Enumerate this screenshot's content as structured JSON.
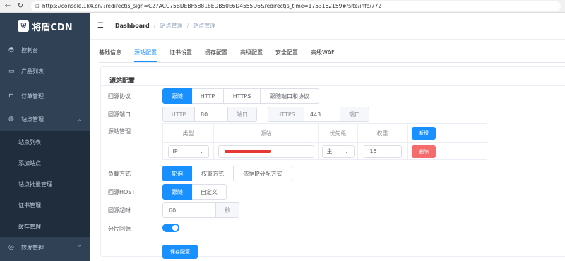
{
  "browser": {
    "url": "https://console.1k4.cn/?redirectjs_sign=C27ACC75BDEBF58818EDB50E6D4555D6&redirectjs_time=1753162159#/site/info/772"
  },
  "sidebar": {
    "logo_text": "将盾CDN",
    "items": [
      {
        "label": "控制台",
        "icon": "dashboard-icon"
      },
      {
        "label": "产品列表",
        "icon": "box-icon"
      },
      {
        "label": "订单管理",
        "icon": "cart-icon"
      },
      {
        "label": "站点管理",
        "icon": "site-icon"
      },
      {
        "label": "转发管理",
        "icon": "forward-icon"
      }
    ],
    "subitems": [
      "站点列表",
      "添加站点",
      "站点批量管理",
      "证书管理",
      "缓存管理"
    ]
  },
  "header": {
    "breadcrumb": [
      "Dashboard",
      "站点管理",
      "站点管理"
    ]
  },
  "tabs": [
    "基础信息",
    "源站配置",
    "证书设置",
    "缓存配置",
    "高级配置",
    "安全配置",
    "高级WAF"
  ],
  "active_tab": "源站配置",
  "form": {
    "title": "源站配置",
    "protocol": {
      "label": "回源协议",
      "options": [
        "跟随",
        "HTTP",
        "HTTPS",
        "跟随端口和协议"
      ],
      "selected": "跟随"
    },
    "port": {
      "label": "回源端口",
      "http_label": "HTTP",
      "http_value": "80",
      "unit1": "端口",
      "https_label": "HTTPS",
      "https_value": "443",
      "unit2": "端口"
    },
    "origin": {
      "label": "源站管理",
      "columns": [
        "类型",
        "源站",
        "优先级",
        "权重"
      ],
      "add_button": "新增",
      "row": {
        "type": "IP",
        "origin": "",
        "priority": "主",
        "weight": "15",
        "delete_button": "删除"
      }
    },
    "balance": {
      "label": "负载方式",
      "options": [
        "轮询",
        "权重方式",
        "依据IP分配方式"
      ],
      "selected": "轮询"
    },
    "host": {
      "label": "回源HOST",
      "options": [
        "跟随",
        "自定义"
      ],
      "selected": "跟随"
    },
    "timeout": {
      "label": "回源超时",
      "value": "60",
      "unit": "秒"
    },
    "range": {
      "label": "分片回源",
      "enabled": true
    },
    "save_button": "保存配置"
  },
  "colors": {
    "primary": "#1890ff",
    "danger": "#f56c6c",
    "sidebar_bg": "#304156",
    "redact": "#e53935"
  }
}
